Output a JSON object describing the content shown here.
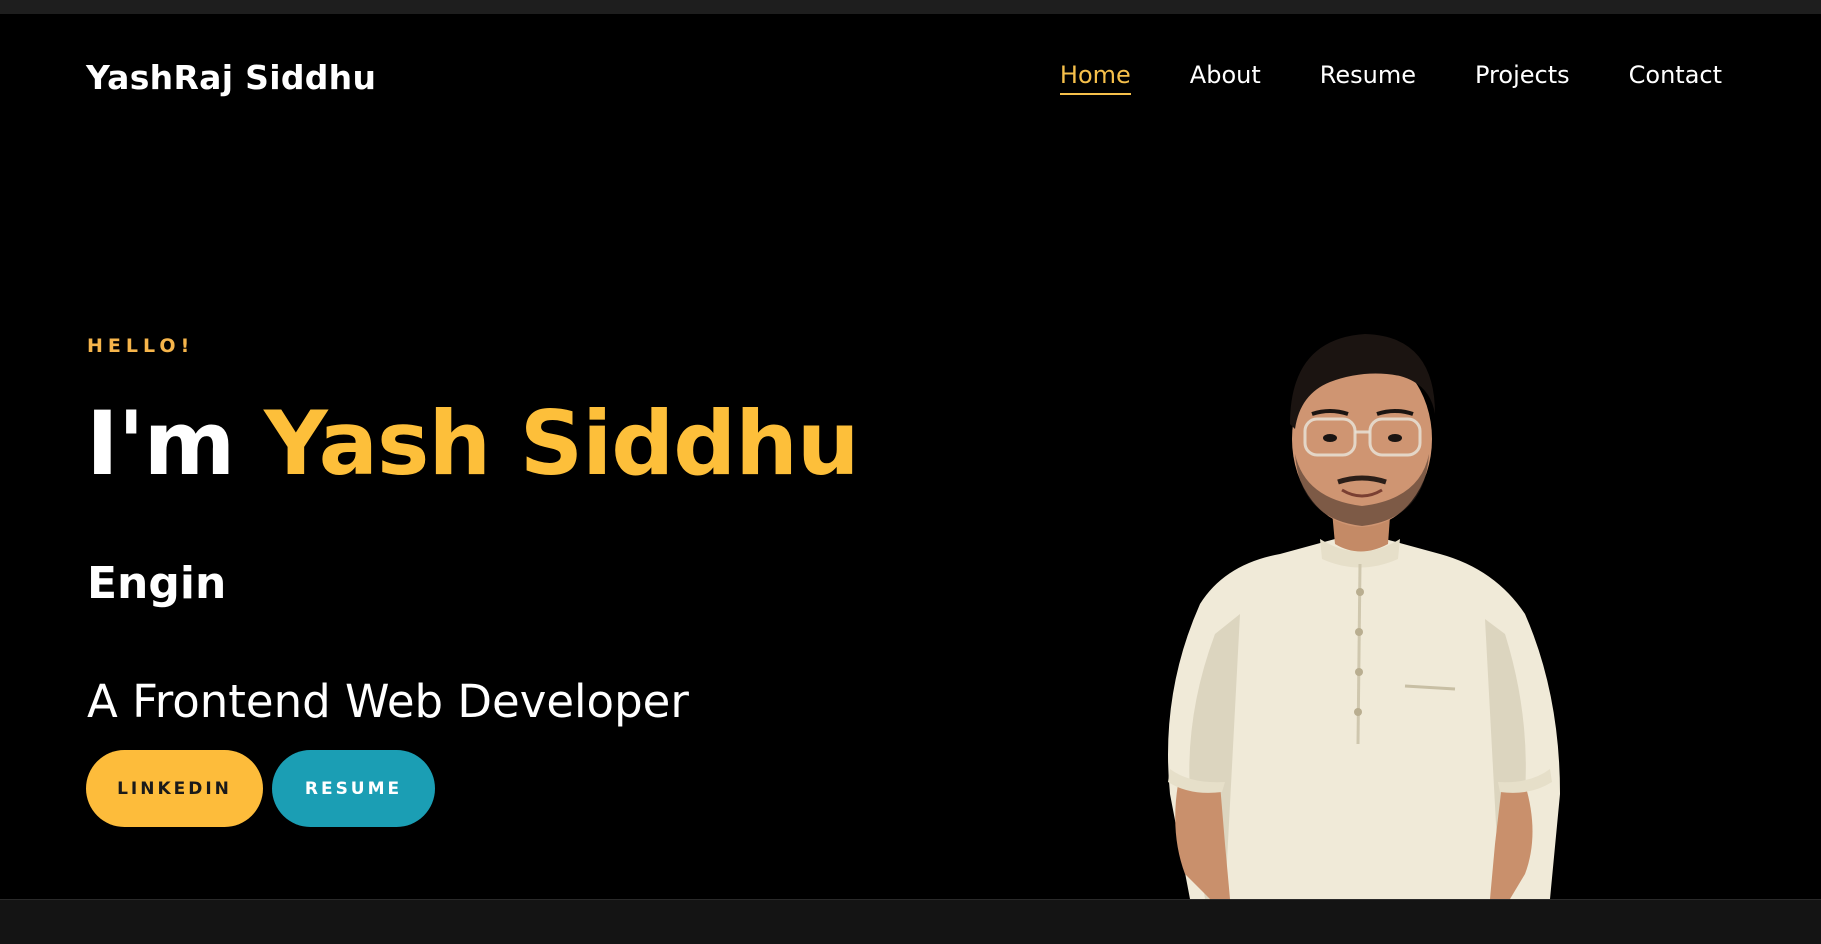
{
  "brand": {
    "name": "YashRaj Siddhu"
  },
  "nav": {
    "items": [
      {
        "label": "Home",
        "active": true
      },
      {
        "label": "About",
        "active": false
      },
      {
        "label": "Resume",
        "active": false
      },
      {
        "label": "Projects",
        "active": false
      },
      {
        "label": "Contact",
        "active": false
      }
    ]
  },
  "hero": {
    "greeting": "HELLO!",
    "intro_prefix": "I'm",
    "intro_name": "Yash Siddhu",
    "typed_text": "Engin",
    "subtitle": "A Frontend Web Developer",
    "buttons": {
      "linkedin": "LINKEDIN",
      "resume": "RESUME"
    }
  },
  "colors": {
    "accent": "#fdbf3a",
    "nav_active": "#f6c04b",
    "resume_button": "#1b9eb4",
    "background": "#000000"
  },
  "icons": {
    "portrait": "profile-photo"
  }
}
